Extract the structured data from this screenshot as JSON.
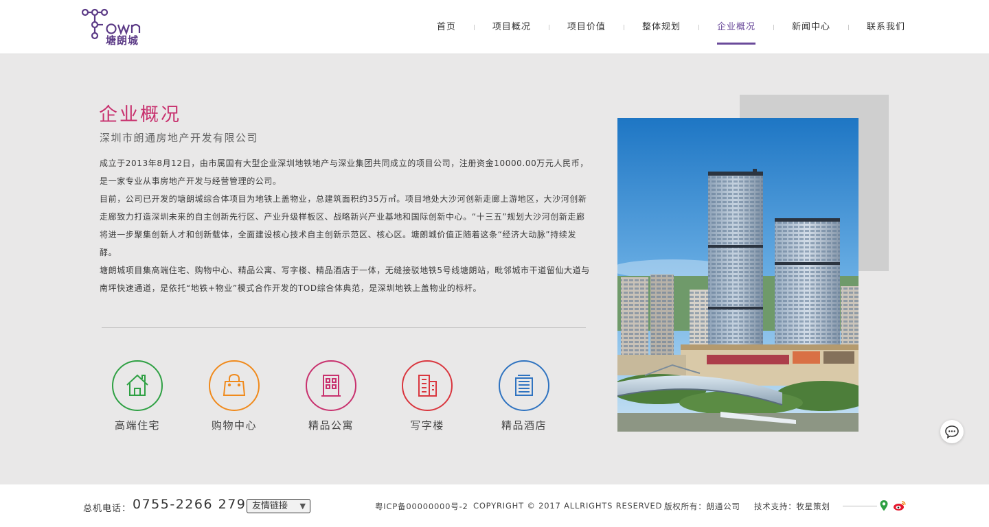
{
  "brand": {
    "logo_text": "塘朗城",
    "accent": "#6a4a9a"
  },
  "nav": {
    "items": [
      {
        "label": "首页"
      },
      {
        "label": "项目概况"
      },
      {
        "label": "项目价值"
      },
      {
        "label": "整体规划"
      },
      {
        "label": "企业概况",
        "active": true
      },
      {
        "label": "新闻中心"
      },
      {
        "label": "联系我们"
      }
    ]
  },
  "main": {
    "title": "企业概况",
    "subtitle": "深圳市朗通房地产开发有限公司",
    "paragraphs": [
      "成立于2013年8月12日，由市属国有大型企业深圳地铁地产与深业集团共同成立的项目公司，注册资金10000.00万元人民币，是一家专业从事房地产开发与经营管理的公司。",
      "目前，公司已开发的塘朗城综合体项目为地铁上盖物业，总建筑面积约35万㎡。项目地处大沙河创新走廊上游地区，大沙河创新走廊致力打造深圳未来的自主创新先行区、产业升级样板区、战略新兴产业基地和国际创新中心。“十三五”规划大沙河创新走廊将进一步聚集创新人才和创新载体，全面建设核心技术自主创新示范区、核心区。塘朗城价值正随着这条“经济大动脉”持续发酵。",
      "塘朗城项目集高端住宅、购物中心、精品公寓、写字楼、精品酒店于一体，无缝接驳地铁5号线塘朗站，毗邻城市干道留仙大道与南坪快速通道，是依托“地铁+物业”模式合作开发的TOD综合体典范，是深圳地铁上盖物业的标杆。"
    ],
    "features": [
      {
        "label": "高端住宅",
        "icon": "house-icon",
        "color": "#2ea043"
      },
      {
        "label": "购物中心",
        "icon": "shopping-bag-icon",
        "color": "#f08a1c"
      },
      {
        "label": "精品公寓",
        "icon": "apartment-icon",
        "color": "#c8316e"
      },
      {
        "label": "写字楼",
        "icon": "office-building-icon",
        "color": "#d9363e"
      },
      {
        "label": "精品酒店",
        "icon": "hotel-icon",
        "color": "#2f73c0"
      }
    ]
  },
  "footer": {
    "phone_label": "总机电话：",
    "phone": "0755-2266 2799",
    "links_label": "友情链接",
    "icp": "粤ICP备00000000号-2",
    "copyright": "COPYRIGHT © 2017 ALLRIGHTS RESERVED",
    "rights": "版权所有：朗通公司",
    "support": "技术支持：牧星策划"
  }
}
